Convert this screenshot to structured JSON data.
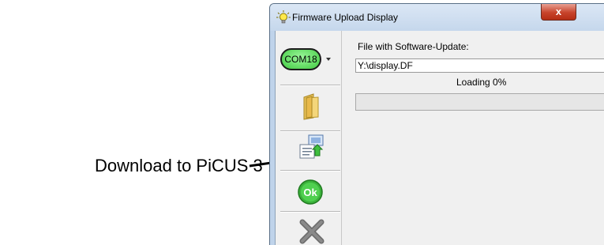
{
  "annotation": {
    "text": "Download to PiCUS 3"
  },
  "window": {
    "title": "Firmware Upload Display",
    "close_label": "x"
  },
  "sidebar": {
    "com_port": "COM18"
  },
  "main": {
    "file_label": "File with Software-Update:",
    "file_value": "Y:\\display.DF",
    "loading_text": "Loading 0%",
    "progress_percent": 0
  },
  "icons": {
    "title": "lightbulb-icon",
    "open": "folder-icon",
    "download": "download-to-device-icon",
    "ok": "ok-icon",
    "cancel": "cancel-x-icon"
  },
  "colors": {
    "com_button": "#5fe05f",
    "ok_button": "#3bb13b",
    "close_button": "#c7432b"
  }
}
